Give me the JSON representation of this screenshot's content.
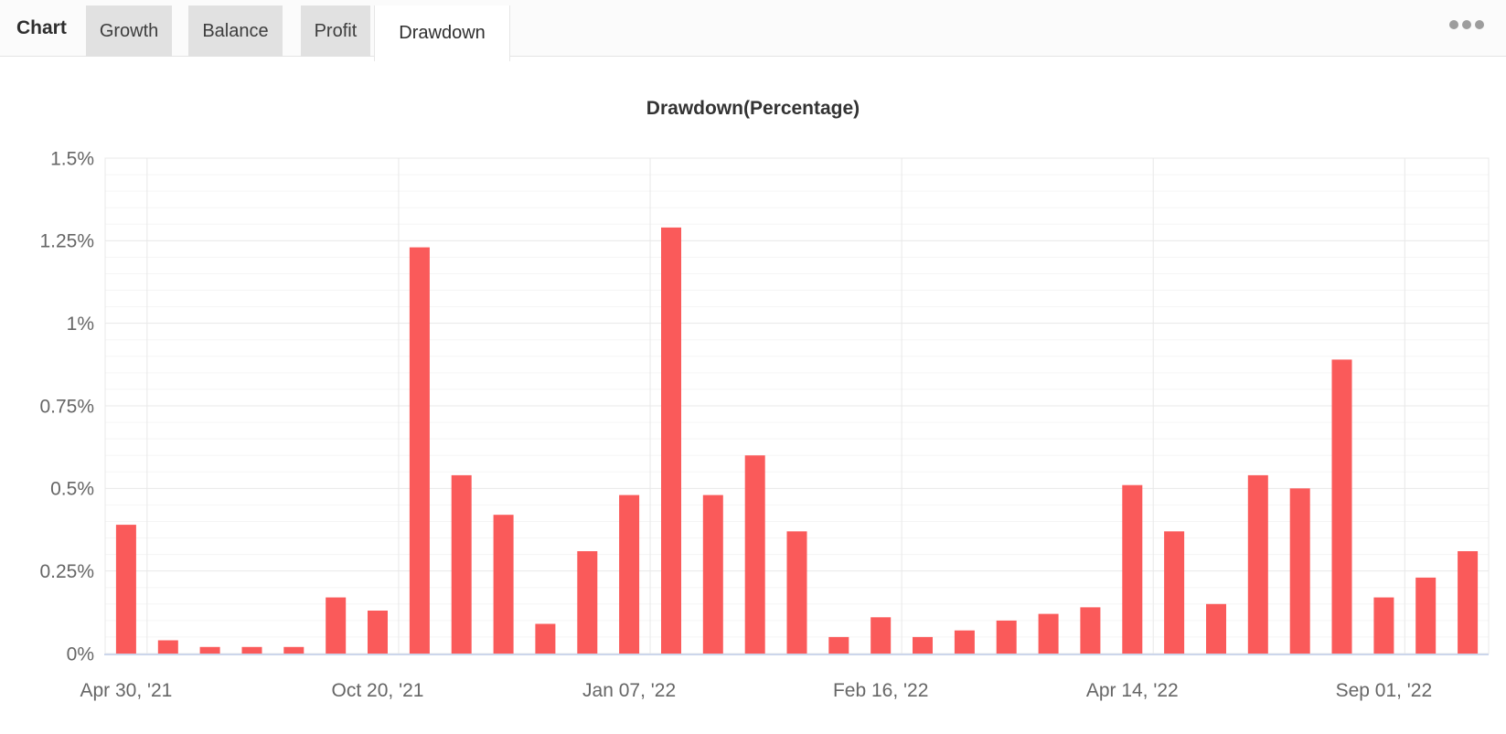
{
  "tabbar": {
    "section_label": "Chart",
    "tabs": [
      {
        "label": "Growth",
        "active": false
      },
      {
        "label": "Balance",
        "active": false
      },
      {
        "label": "Profit",
        "active": false
      },
      {
        "label": "Drawdown",
        "active": true
      }
    ],
    "menu_icon": "ellipsis-icon"
  },
  "chart_data": {
    "type": "bar",
    "title": "Drawdown(Percentage)",
    "xlabel": "",
    "ylabel": "",
    "ylim": [
      0,
      1.5
    ],
    "y_major_step": 0.25,
    "y_minor_step": 0.05,
    "y_tick_labels": [
      "0%",
      "0.25%",
      "0.5%",
      "0.75%",
      "1%",
      "1.25%",
      "1.5%"
    ],
    "x_tick_positions": [
      0,
      6,
      12,
      18,
      24,
      30
    ],
    "x_tick_labels": [
      "Apr 30, '21",
      "Oct 20, '21",
      "Jan 07, '22",
      "Feb 16, '22",
      "Apr 14, '22",
      "Sep 01, '22"
    ],
    "values": [
      0.39,
      0.04,
      0.02,
      0.02,
      0.02,
      0.17,
      0.13,
      1.23,
      0.54,
      0.42,
      0.09,
      0.31,
      0.48,
      1.29,
      0.48,
      0.6,
      0.37,
      0.05,
      0.11,
      0.05,
      0.07,
      0.1,
      0.12,
      0.14,
      0.51,
      0.37,
      0.15,
      0.54,
      0.5,
      0.89,
      0.17,
      0.23,
      0.31
    ],
    "grid": true,
    "legend": false,
    "series_color": "#fa5a5a",
    "axis_line_color": "#ccd6eb",
    "major_grid_color": "#e8e8e8",
    "minor_grid_color": "#f5f5f5",
    "label_color": "#666666",
    "title_color": "#333333"
  }
}
